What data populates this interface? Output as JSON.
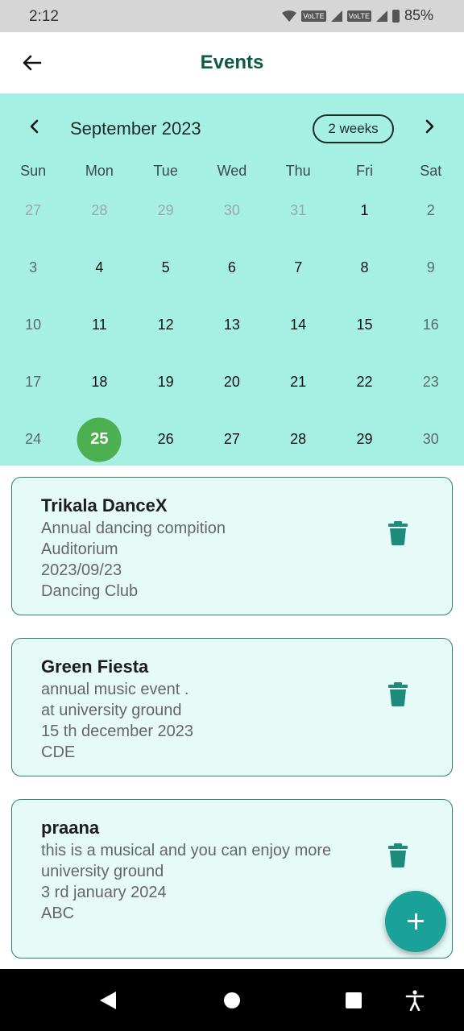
{
  "status": {
    "time": "2:12",
    "battery": "85%",
    "volte1": "VoLTE",
    "volte2": "VoLTE"
  },
  "appbar": {
    "title": "Events",
    "back_icon": "arrow-left-icon"
  },
  "calendar": {
    "month_label": "September 2023",
    "format_button": "2 weeks",
    "weekdays": [
      "Sun",
      "Mon",
      "Tue",
      "Wed",
      "Thu",
      "Fri",
      "Sat"
    ],
    "weeks": [
      [
        "27",
        "28",
        "29",
        "30",
        "31",
        "1",
        "2"
      ],
      [
        "3",
        "4",
        "5",
        "6",
        "7",
        "8",
        "9"
      ],
      [
        "10",
        "11",
        "12",
        "13",
        "14",
        "15",
        "16"
      ],
      [
        "17",
        "18",
        "19",
        "20",
        "21",
        "22",
        "23"
      ],
      [
        "24",
        "25",
        "26",
        "27",
        "28",
        "29",
        "30"
      ]
    ],
    "selected_day": "25",
    "colors": {
      "background": "#a6f0e3",
      "selected": "#4caf50"
    }
  },
  "events": [
    {
      "name": "Trikala DanceX",
      "lines": [
        "Annual dancing compition",
        "Auditorium",
        "2023/09/23",
        "Dancing Club"
      ]
    },
    {
      "name": "Green Fiesta",
      "lines": [
        "annual music event .",
        "at university ground",
        "15 th december 2023",
        "CDE"
      ]
    },
    {
      "name": "praana",
      "lines": [
        "this is  a  musical and you can enjoy more",
        "university ground",
        "3 rd january 2024",
        "ABC"
      ]
    }
  ],
  "colors": {
    "accent": "#0f5a45",
    "card_bg": "#e6fbf8",
    "card_border": "#2f7d70",
    "fab": "#1aa19a"
  },
  "fab": {
    "icon": "plus-icon"
  },
  "navbar": {
    "icons": [
      "nav-back-icon",
      "nav-home-icon",
      "nav-recents-icon",
      "accessibility-icon"
    ]
  }
}
